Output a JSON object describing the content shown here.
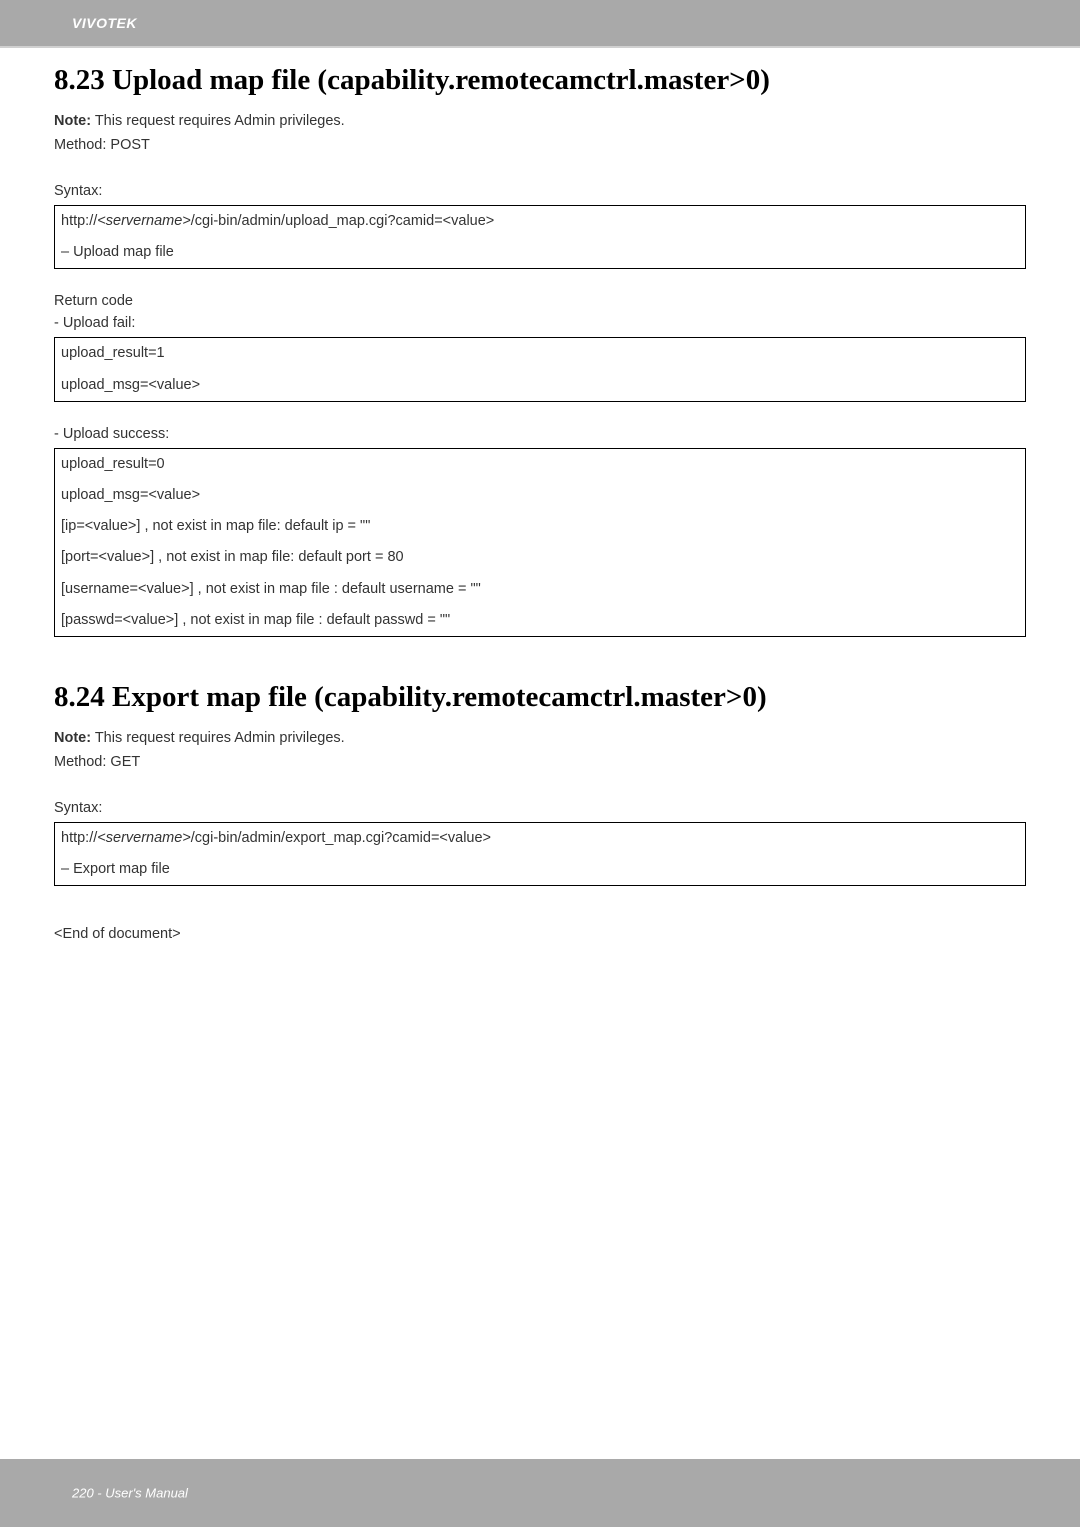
{
  "header": {
    "brand": "VIVOTEK"
  },
  "section1": {
    "heading": "8.23 Upload map file (capability.remotecamctrl.master>0)",
    "noteLabel": "Note:",
    "noteText": " This request requires Admin privileges.",
    "method": "Method: POST",
    "syntaxLabel": "Syntax:",
    "syntaxBox": {
      "line1a": "http://",
      "line1b": "<servername>",
      "line1c": "/cgi-bin/admin/upload_map.cgi?camid=<value>",
      "line2": "– Upload map file"
    },
    "returnCodeLabel": "Return code",
    "failLabel": "- Upload fail:",
    "failBox": {
      "line1": "upload_result=1",
      "line2": "upload_msg=<value>"
    },
    "successLabel": "- Upload success:",
    "successBox": {
      "line1": "upload_result=0",
      "line2": "upload_msg=<value>",
      "line3": "[ip=<value>] , not exist in map file: default ip = \"\"",
      "line4": "[port=<value>] , not exist in map file: default port = 80",
      "line5": "[username=<value>] , not exist in map file : default username = \"\"",
      "line6": "[passwd=<value>] , not exist in map file : default passwd = \"\""
    }
  },
  "section2": {
    "heading": "8.24 Export map file (capability.remotecamctrl.master>0)",
    "noteLabel": "Note:",
    "noteText": " This request requires Admin privileges.",
    "method": "Method: GET",
    "syntaxLabel": "Syntax:",
    "syntaxBox": {
      "line1a": "http://",
      "line1b": "<servername>",
      "line1c": "/cgi-bin/admin/export_map.cgi?camid=<value>",
      "line2": "– Export map file"
    }
  },
  "endDoc": "<End of document>",
  "footer": {
    "text": "220 - User's Manual"
  }
}
